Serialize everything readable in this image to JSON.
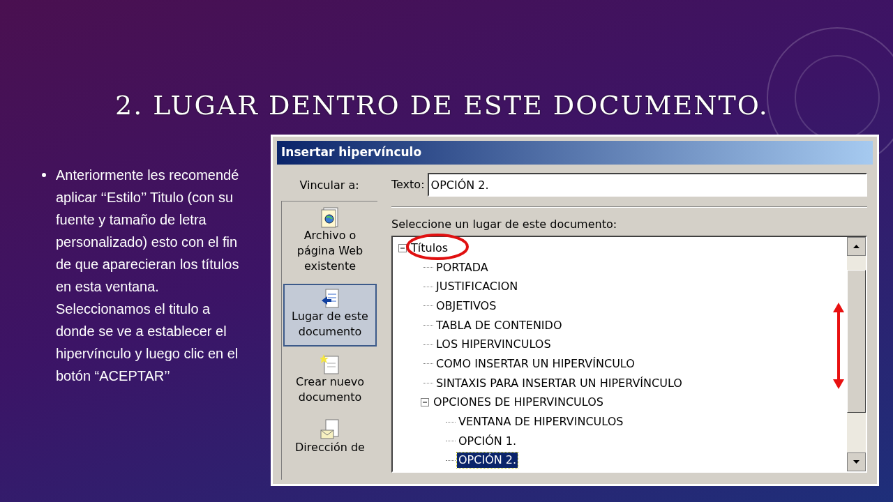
{
  "slide": {
    "title": "2. LUGAR DENTRO DE ESTE DOCUMENTO.",
    "bullets": [
      "Anteriormente les recomendé aplicar ‘‘Estilo’’ Titulo (con su fuente y tamaño de letra personalizado) esto con el fin de que aparecieran los títulos en esta ventana. Seleccionamos el titulo a donde se ve a establecer el hipervínculo y luego clic en el botón “ACEPTAR’’"
    ]
  },
  "dialog": {
    "title": "Insertar hipervínculo",
    "link_to_label": "Vincular a:",
    "link_to_items": [
      {
        "label": "Archivo o página Web existente",
        "selected": false
      },
      {
        "label": "Lugar de este documento",
        "selected": true
      },
      {
        "label": "Crear nuevo documento",
        "selected": false
      },
      {
        "label": "Dirección de",
        "selected": false
      }
    ],
    "text_label": "Texto:",
    "text_value": "OPCIÓN 2.",
    "place_label": "Seleccione un lugar de este documento:",
    "tree": [
      {
        "label": "Títulos",
        "expanded": true,
        "selected": false,
        "children": [
          {
            "label": "PORTADA",
            "selected": false
          },
          {
            "label": "JUSTIFICACION",
            "selected": false
          },
          {
            "label": "OBJETIVOS",
            "selected": false
          },
          {
            "label": "TABLA DE CONTENIDO",
            "selected": false
          },
          {
            "label": "LOS HIPERVINCULOS",
            "selected": false
          },
          {
            "label": "COMO INSERTAR UN HIPERVÍNCULO",
            "selected": false
          },
          {
            "label": "SINTAXIS PARA INSERTAR UN HIPERVÍNCULO",
            "selected": false
          },
          {
            "label": "OPCIONES DE HIPERVINCULOS",
            "expanded": true,
            "selected": false,
            "children": [
              {
                "label": "VENTANA DE HIPERVINCULOS",
                "selected": false
              },
              {
                "label": "OPCIÓN 1.",
                "selected": false
              },
              {
                "label": "OPCIÓN 2.",
                "selected": true
              }
            ]
          }
        ]
      }
    ]
  }
}
